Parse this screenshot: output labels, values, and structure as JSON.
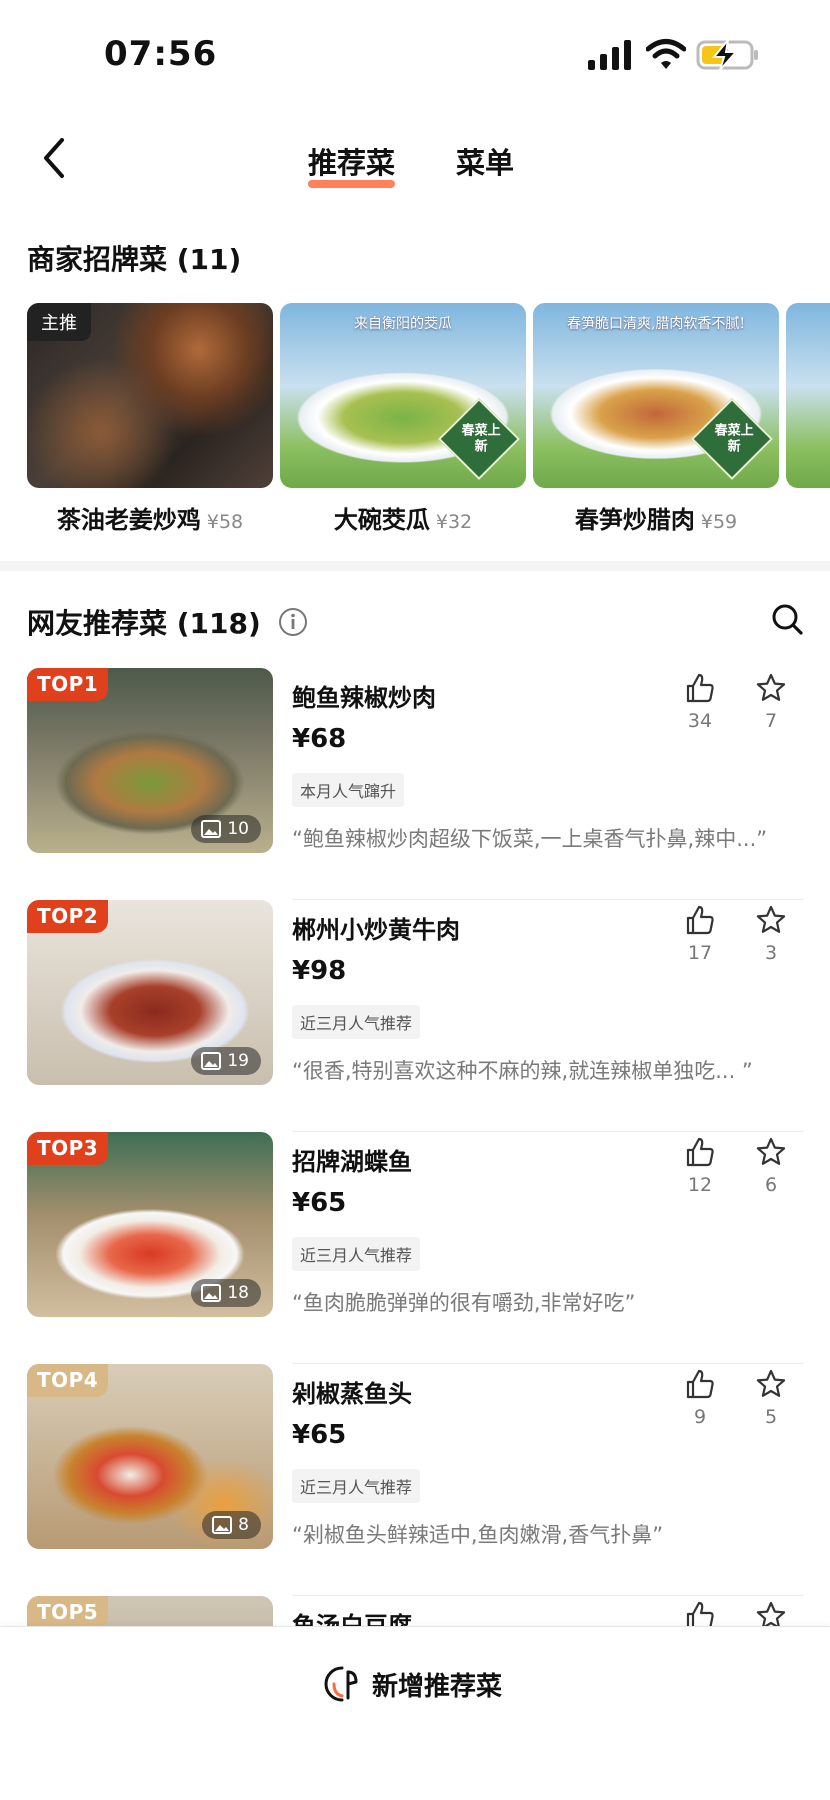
{
  "status_bar": {
    "time": "07:56"
  },
  "header": {
    "tabs": [
      {
        "label": "推荐菜",
        "active": true
      },
      {
        "label": "菜单",
        "active": false
      }
    ]
  },
  "signature": {
    "title": "商家招牌菜 (11)",
    "items": [
      {
        "name": "茶油老姜炒鸡",
        "price": "¥58",
        "badge": "主推"
      },
      {
        "name": "大碗茭瓜",
        "price": "¥32",
        "caption": "来自衡阳的茭瓜",
        "tag": "春菜上新"
      },
      {
        "name": "春笋炒腊肉",
        "price": "¥59",
        "caption": "春笋脆口清爽,腊肉软香不腻!",
        "tag": "春菜上新"
      }
    ]
  },
  "recommended": {
    "title": "网友推荐菜 (118)",
    "items": [
      {
        "rank": "TOP1",
        "name": "鲍鱼辣椒炒肉",
        "price": "¥68",
        "tag": "本月人气蹿升",
        "quote": "“鲍鱼辣椒炒肉超级下饭菜,一上桌香气扑鼻,辣中...”",
        "images": "10",
        "likes": "34",
        "favorites": "7"
      },
      {
        "rank": "TOP2",
        "name": "郴州小炒黄牛肉",
        "price": "¥98",
        "tag": "近三月人气推荐",
        "quote": "“很香,特别喜欢这种不麻的辣,就连辣椒单独吃... ”",
        "images": "19",
        "likes": "17",
        "favorites": "3"
      },
      {
        "rank": "TOP3",
        "name": "招牌湖蝶鱼",
        "price": "¥65",
        "tag": "近三月人气推荐",
        "quote": "“鱼肉脆脆弹弹的很有嚼劲,非常好吃”",
        "images": "18",
        "likes": "12",
        "favorites": "6"
      },
      {
        "rank": "TOP4",
        "name": "剁椒蒸鱼头",
        "price": "¥65",
        "tag": "近三月人气推荐",
        "quote": "“剁椒鱼头鲜辣适中,鱼肉嫩滑,香气扑鼻”",
        "images": "8",
        "likes": "9",
        "favorites": "5"
      },
      {
        "rank": "TOP5",
        "name": "鱼汤白豆腐"
      }
    ]
  },
  "bottom_bar": {
    "add_label": "新增推荐菜"
  },
  "colors": {
    "accent": "#ff6a3c",
    "top_red": "#e0401c",
    "top_tan": "#d9b887"
  }
}
